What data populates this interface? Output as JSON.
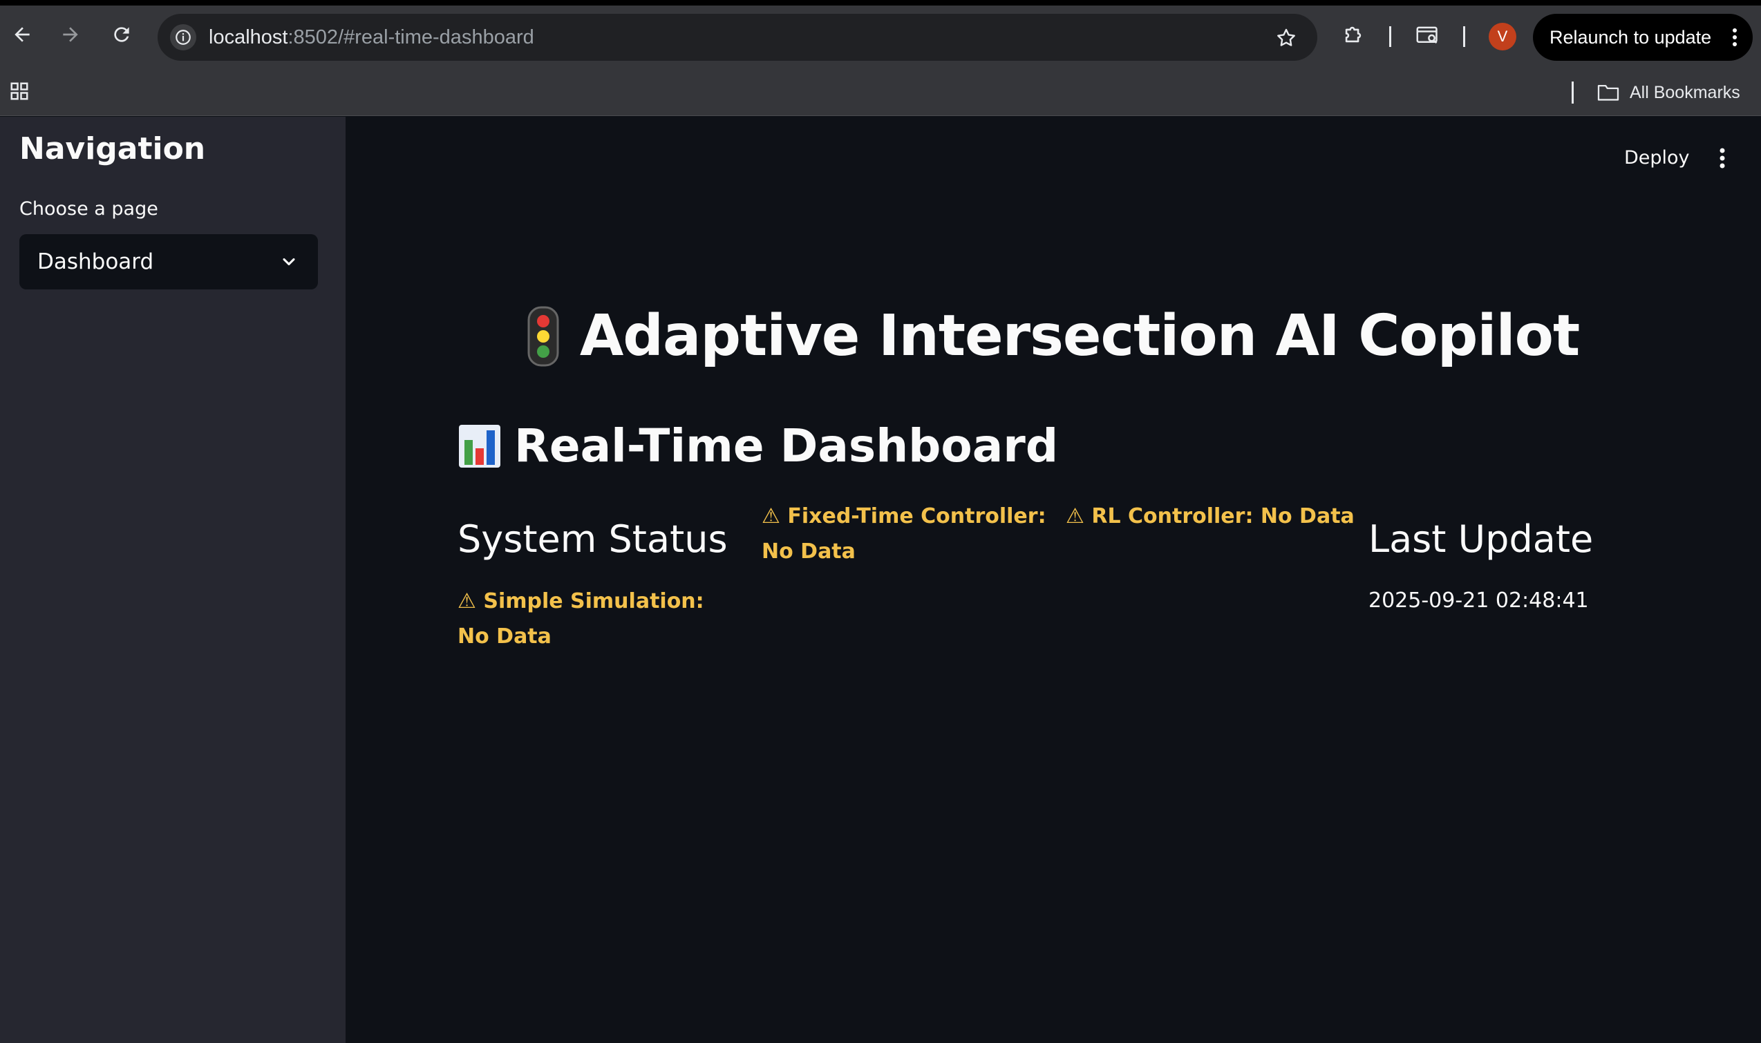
{
  "browser": {
    "url_host": "localhost",
    "url_rest": ":8502/#real-time-dashboard",
    "profile_initial": "V",
    "relaunch_label": "Relaunch to update",
    "bookmarks_label": "All Bookmarks"
  },
  "sidebar": {
    "title": "Navigation",
    "select_label": "Choose a page",
    "select_value": "Dashboard"
  },
  "header": {
    "deploy_label": "Deploy"
  },
  "main": {
    "app_title": "Adaptive Intersection AI Copilot",
    "dashboard_title": "Real-Time Dashboard",
    "system_status_heading": "System Status",
    "last_update_heading": "Last Update",
    "last_update_value": "2025-09-21 02:48:41",
    "warnings": {
      "fixed_time": "⚠ Fixed-Time Controller: No Data",
      "rl": "⚠ RL Controller: No Data",
      "simple_sim": "⚠ Simple Simulation: No Data"
    }
  },
  "colors": {
    "app_bg": "#0e1117",
    "sidebar_bg": "#262730",
    "warning_text": "#f3c14b",
    "avatar_bg": "#c2401c"
  },
  "icons": {
    "title_icon": "traffic-light-icon",
    "dashboard_icon": "bar-chart-icon"
  }
}
